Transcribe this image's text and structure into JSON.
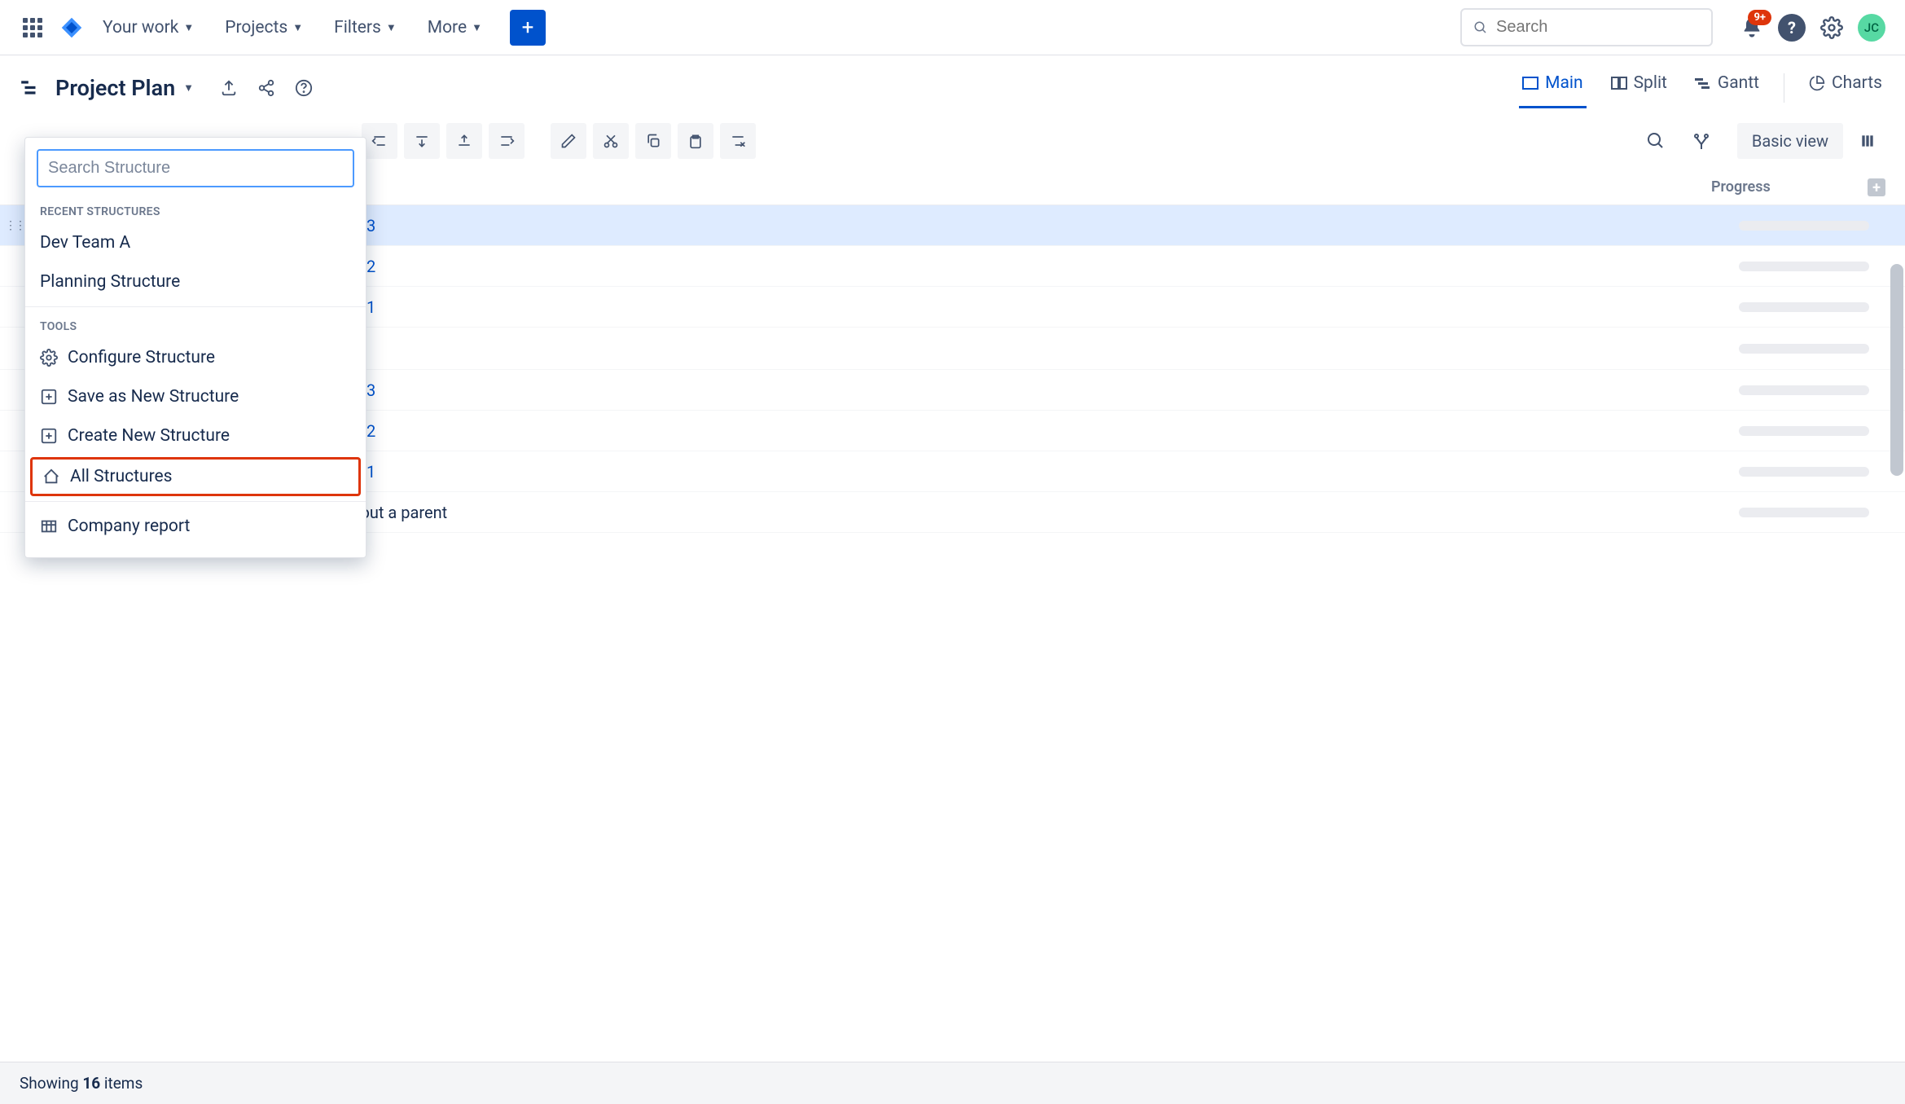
{
  "nav": {
    "your_work": "Your work",
    "projects": "Projects",
    "filters": "Filters",
    "more": "More",
    "search_placeholder": "Search",
    "notification_count": "9+",
    "avatar_initials": "JC"
  },
  "subheader": {
    "title": "Project Plan",
    "tabs": {
      "main": "Main",
      "split": "Split",
      "gantt": "Gantt",
      "charts": "Charts"
    }
  },
  "dropdown": {
    "search_placeholder": "Search Structure",
    "section_recent": "RECENT STRUCTURES",
    "section_tools": "TOOLS",
    "recent": [
      "Dev Team A",
      "Planning Structure"
    ],
    "tools": {
      "configure": "Configure Structure",
      "save_as": "Save as New Structure",
      "create_new": "Create New Structure",
      "all_structures": "All Structures",
      "company_report": "Company report"
    }
  },
  "toolbar": {
    "basic_view": "Basic view"
  },
  "table": {
    "progress_header": "Progress",
    "rows": [
      {
        "key": "3",
        "selected": true
      },
      {
        "key": "2"
      },
      {
        "key": "1"
      },
      {
        "key": "3"
      },
      {
        "key": "2"
      },
      {
        "key": "1"
      }
    ],
    "folder_row": "Issues without a parent"
  },
  "footer": {
    "prefix": "Showing ",
    "count": "16",
    "suffix": " items"
  }
}
